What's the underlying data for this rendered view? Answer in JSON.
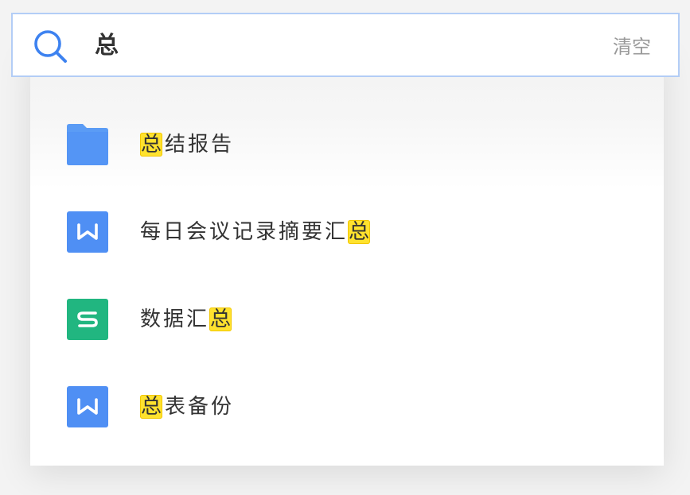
{
  "search": {
    "query": "总",
    "clear_label": "清空"
  },
  "results": [
    {
      "type": "folder",
      "icon": "folder-icon",
      "color": "#5b9cf5",
      "highlight": "总",
      "rest": "结报告",
      "highlight_position": "start"
    },
    {
      "type": "word",
      "icon": "word-doc-icon",
      "color": "#4f8ff4",
      "prefix": "每日会议记录摘要汇",
      "highlight": "总",
      "highlight_position": "end"
    },
    {
      "type": "sheet",
      "icon": "sheet-doc-icon",
      "color": "#21b680",
      "prefix": "数据汇",
      "highlight": "总",
      "highlight_position": "end"
    },
    {
      "type": "word",
      "icon": "word-doc-icon",
      "color": "#4f8ff4",
      "highlight": "总",
      "rest": "表备份",
      "highlight_position": "start"
    }
  ],
  "colors": {
    "accent": "#3d82f0",
    "highlight": "#ffe22e",
    "search_border": "#b3cdf6"
  }
}
